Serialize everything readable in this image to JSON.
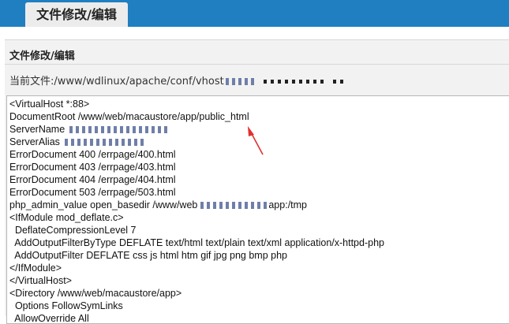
{
  "tab": {
    "label": "文件修改/编辑"
  },
  "panel": {
    "title": "文件修改/编辑",
    "current_file_label": "当前文件:",
    "current_file_path": "/www/wdlinux/apache/conf/vhost"
  },
  "editor": {
    "lines": [
      "<VirtualHost *:88>",
      "DocumentRoot /www/web/macaustore/app/public_html",
      "ServerName",
      "ServerAlias",
      "ErrorDocument 400 /errpage/400.html",
      "ErrorDocument 403 /errpage/403.html",
      "ErrorDocument 404 /errpage/404.html",
      "ErrorDocument 503 /errpage/503.html",
      "php_admin_value open_basedir /www/web",
      "app:/tmp",
      "<IfModule mod_deflate.c>",
      "  DeflateCompressionLevel 7",
      "  AddOutputFilterByType DEFLATE text/html text/plain text/xml application/x-httpd-php",
      "  AddOutputFilter DEFLATE css js html htm gif jpg png bmp php",
      "</IfModule>",
      "</VirtualHost>",
      "<Directory /www/web/macaustore/app>",
      "  Options FollowSymLinks",
      "  AllowOverride All"
    ]
  },
  "colors": {
    "header_bar": "#1f7fc1",
    "annotation_arrow": "#e03030"
  }
}
